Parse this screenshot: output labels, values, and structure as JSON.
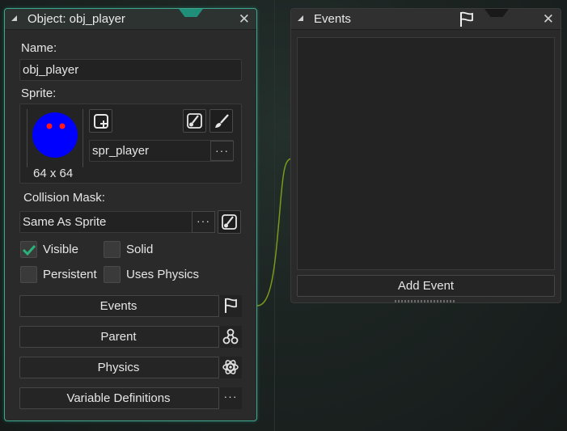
{
  "object_panel": {
    "title": "Object: obj_player",
    "name_label": "Name:",
    "name_value": "obj_player",
    "sprite_label": "Sprite:",
    "sprite_name": "spr_player",
    "sprite_size": "64 x 64",
    "sprite_colors": {
      "body": "#0000ff",
      "eyes": "#ff1a1a"
    },
    "collision_label": "Collision Mask:",
    "collision_value": "Same As Sprite",
    "checkboxes": {
      "visible": {
        "label": "Visible",
        "checked": true
      },
      "solid": {
        "label": "Solid",
        "checked": false
      },
      "persistent": {
        "label": "Persistent",
        "checked": false
      },
      "uses_physics": {
        "label": "Uses Physics",
        "checked": false
      }
    },
    "buttons": {
      "events": "Events",
      "parent": "Parent",
      "physics": "Physics",
      "variable_definitions": "Variable Definitions"
    },
    "ellipsis": "···",
    "close_glyph": "✕"
  },
  "events_panel": {
    "title": "Events",
    "add_event": "Add Event",
    "close_glyph": "✕"
  },
  "icons": [
    "collapse-triangle-icon",
    "close-icon",
    "new-sprite-icon",
    "edit-image-icon",
    "brush-icon",
    "flag-icon",
    "parent-hierarchy-icon",
    "atom-icon",
    "ellipsis-icon",
    "checkmark-icon"
  ],
  "colors": {
    "accent": "#3fa58e",
    "checkmark": "#29b37a",
    "wire": "#7a9a1a"
  }
}
